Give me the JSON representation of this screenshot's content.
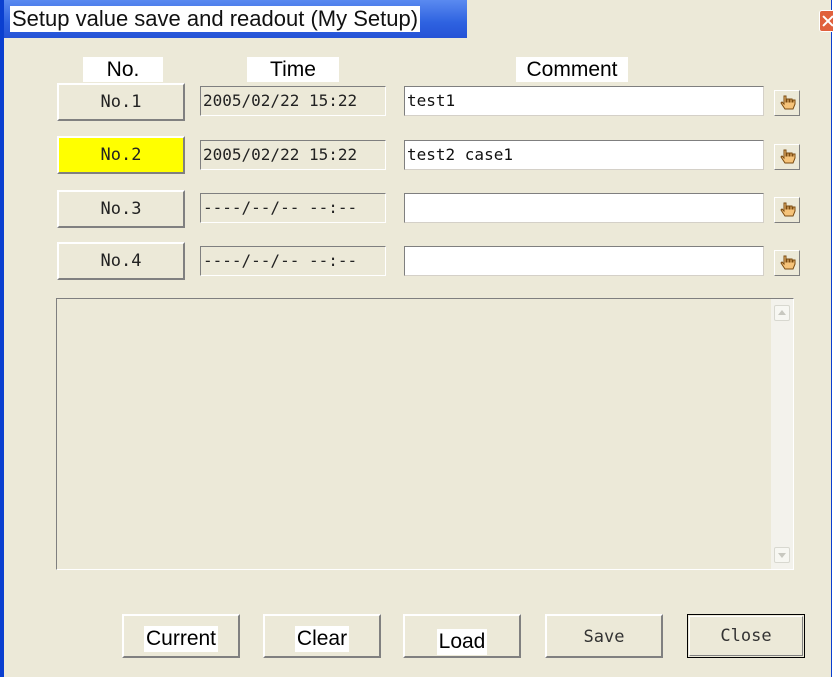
{
  "window": {
    "title": "Setup value save and readout (My Setup)"
  },
  "headers": {
    "no": "No.",
    "time": "Time",
    "comment": "Comment"
  },
  "slots": [
    {
      "label": "No.1",
      "time": "2005/02/22 15:22",
      "comment": "test1",
      "selected": false
    },
    {
      "label": "No.2",
      "time": "2005/02/22 15:22",
      "comment": "test2 case1",
      "selected": true
    },
    {
      "label": "No.3",
      "time": "----/--/-- --:--",
      "comment": "",
      "selected": false
    },
    {
      "label": "No.4",
      "time": "----/--/-- --:--",
      "comment": "",
      "selected": false
    }
  ],
  "buttons": {
    "current": "Current",
    "clear": "Clear",
    "load": "Load",
    "save": "Save",
    "close": "Close"
  },
  "icons": {
    "edit": "pointing-hand-icon",
    "window_close": "close-icon"
  },
  "colors": {
    "selected": "#ffff00",
    "titlebar": "#2e62e0",
    "face": "#ece9d8"
  }
}
